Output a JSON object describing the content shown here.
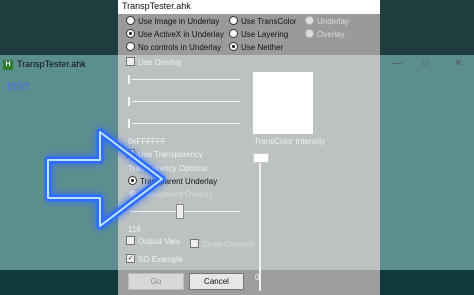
{
  "background_window": {
    "title": "TranspTester.ahk",
    "text": "TEST",
    "controls": [
      "—",
      "□",
      "✕"
    ]
  },
  "dialog": {
    "title": "TranspTester.ahk",
    "top_options": {
      "col1": [
        "Use Image in Underlay",
        "Use ActiveX in Underlay",
        "No controls in Underlay"
      ],
      "col2": [
        "Use TransColor",
        "Use Layering",
        "Use Neither"
      ],
      "col3": [
        "Underlay",
        "Overlay"
      ]
    },
    "use_overlay": "Use Overlay",
    "color_value": "0xFFFFFF",
    "trans_color_label": "TransColor Intensity",
    "use_transparency": "Use Transparency",
    "transparency_options": "Transparency Options:",
    "transparent_underlay": "Transparent Underlay",
    "transparent_overlay": "Transparent Overlay",
    "slider_value": "118",
    "output_vars": "Output Vars",
    "output_vars_right": "Show Controls",
    "so_example": "SO Example",
    "go_button": "Go",
    "cancel_button": "Cancel",
    "intensity_value": "0"
  },
  "colors": {
    "teal": "#5d8e8e",
    "dark_teal": "#0f3b3c",
    "arrow_glow": "#2f6dff"
  }
}
